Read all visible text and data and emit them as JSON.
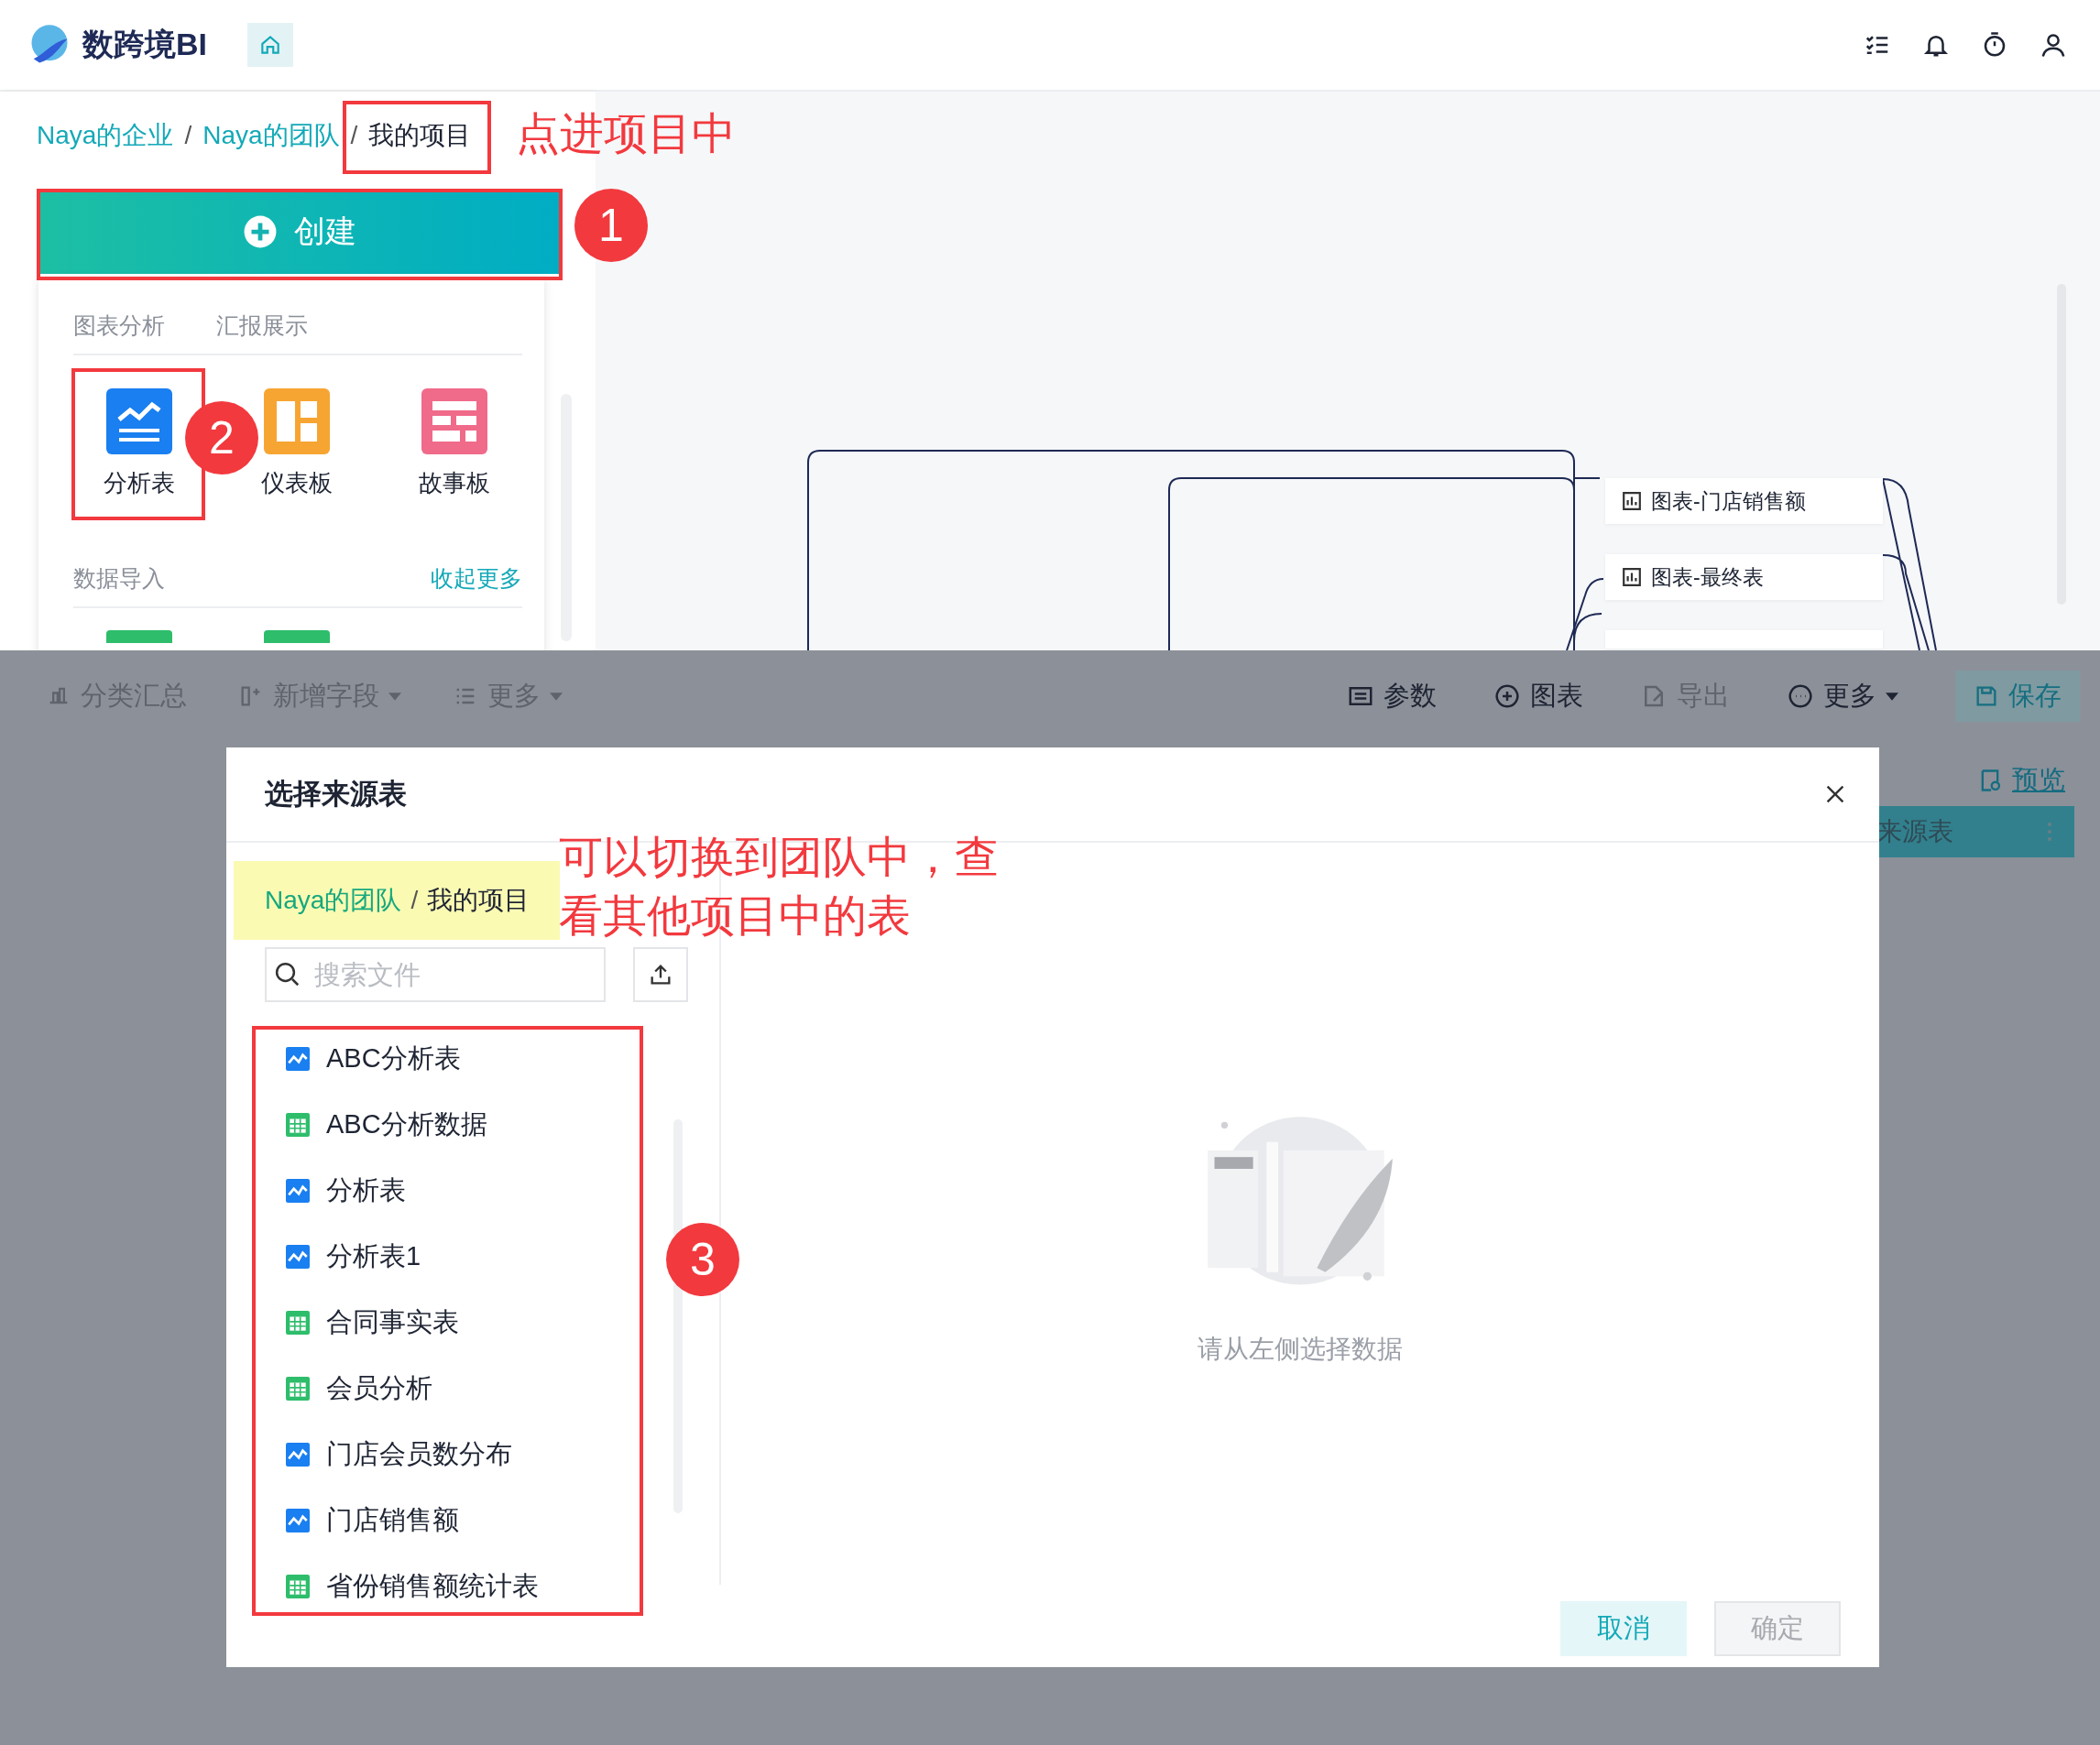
{
  "header": {
    "logo_text": "数跨境BI"
  },
  "breadcrumb": [
    {
      "label": "Naya的企业",
      "current": false
    },
    {
      "separator": "/",
      "label": "Naya的团队",
      "current": false
    },
    {
      "separator": "/",
      "label": "我的项目",
      "current": true
    }
  ],
  "create_button": {
    "label": "创建"
  },
  "create_menu": {
    "tabs": [
      {
        "label": "图表分析"
      },
      {
        "label": "汇报展示"
      }
    ],
    "items": [
      {
        "label": "分析表",
        "kind": "analysis"
      },
      {
        "label": "仪表板",
        "kind": "dashboard"
      },
      {
        "label": "故事板",
        "kind": "story"
      }
    ],
    "import_title": "数据导入",
    "import_link": "收起更多"
  },
  "canvas": {
    "nodes": [
      {
        "label": "图表-门店销售额"
      },
      {
        "label": "图表-最终表"
      }
    ]
  },
  "toolbar": {
    "left": [
      {
        "label": "分类汇总",
        "disabled": true,
        "dropdown": false
      },
      {
        "label": "新增字段",
        "disabled": true,
        "dropdown": true
      },
      {
        "label": "更多",
        "disabled": true,
        "dropdown": true
      }
    ],
    "right": [
      {
        "label": "参数",
        "disabled": false,
        "dropdown": false
      },
      {
        "label": "图表",
        "disabled": false,
        "dropdown": false
      },
      {
        "label": "导出",
        "disabled": true,
        "dropdown": false
      },
      {
        "label": "更多",
        "disabled": false,
        "dropdown": true
      }
    ],
    "save": "保存"
  },
  "preview_link": "预览",
  "source_bar": "来源表",
  "dialog": {
    "title": "选择来源表",
    "breadcrumb": [
      {
        "label": "Naya的团队",
        "current": false
      },
      {
        "separator": "/",
        "label": "我的项目",
        "current": true
      }
    ],
    "search": {
      "placeholder": "搜索文件"
    },
    "files": [
      {
        "name": "ABC分析表",
        "kind": "analysis"
      },
      {
        "name": "ABC分析数据",
        "kind": "table"
      },
      {
        "name": "分析表",
        "kind": "analysis"
      },
      {
        "name": "分析表1",
        "kind": "analysis"
      },
      {
        "name": "合同事实表",
        "kind": "table"
      },
      {
        "name": "会员分析",
        "kind": "table"
      },
      {
        "name": "门店会员数分布",
        "kind": "analysis"
      },
      {
        "name": "门店销售额",
        "kind": "analysis"
      },
      {
        "name": "省份销售额统计表",
        "kind": "table"
      }
    ],
    "empty_text": "请从左侧选择数据",
    "buttons": [
      {
        "label": "取消",
        "kind": "secondary"
      },
      {
        "label": "确定",
        "kind": "disabled"
      }
    ]
  },
  "annotations": {
    "notes": [
      "点进项目中",
      "可以切换到团队中，查看其他项目中的表"
    ],
    "markers": [
      "1",
      "2",
      "3"
    ]
  }
}
